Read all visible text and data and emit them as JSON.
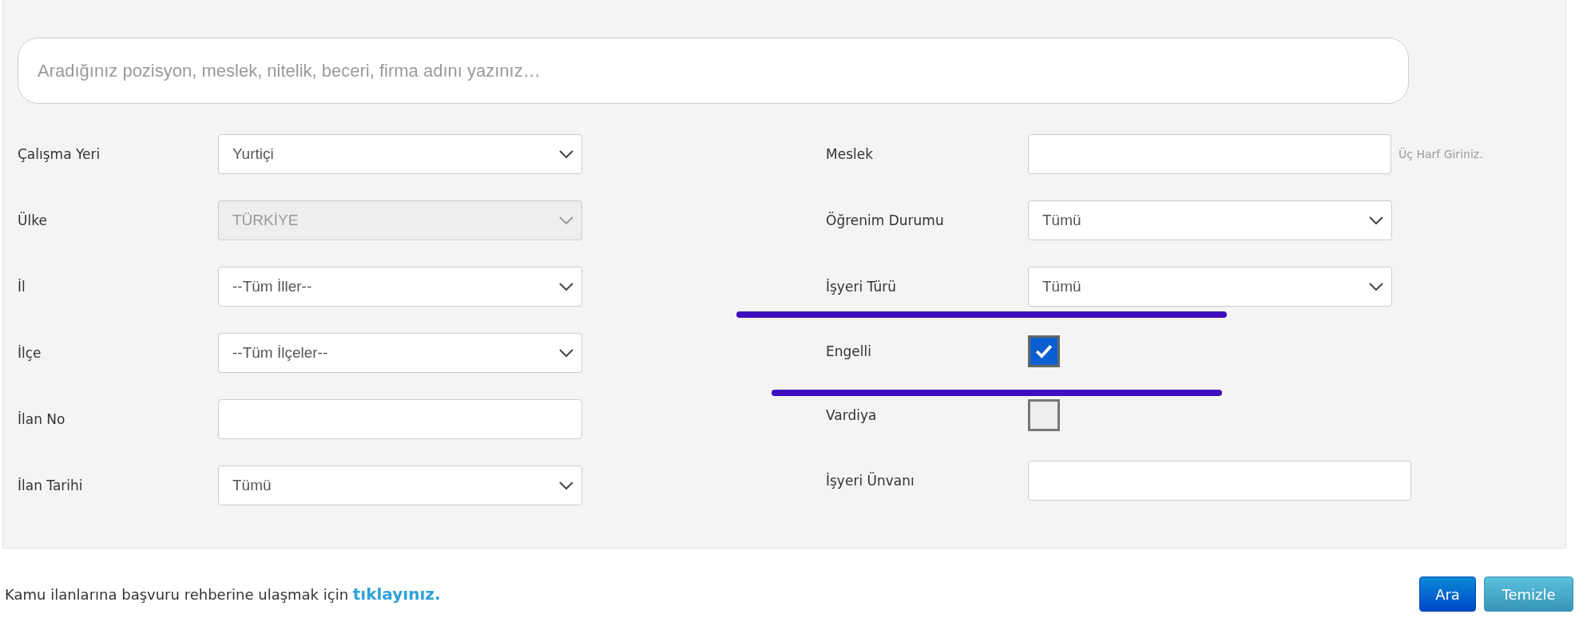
{
  "search": {
    "placeholder": "Aradığınız pozisyon, meslek, nitelik, beceri, firma adını yazınız…"
  },
  "left_fields": [
    {
      "label": "Çalışma Yeri",
      "kind": "select",
      "value": "Yurtiçi",
      "disabled": false
    },
    {
      "label": "Ülke",
      "kind": "select",
      "value": "TÜRKİYE",
      "disabled": true
    },
    {
      "label": "İl",
      "kind": "select",
      "value": "--Tüm İller--",
      "disabled": false
    },
    {
      "label": "İlçe",
      "kind": "select",
      "value": "--Tüm İlçeler--",
      "disabled": false
    },
    {
      "label": "İlan No",
      "kind": "input"
    },
    {
      "label": "İlan Tarihi",
      "kind": "select",
      "value": "Tümü",
      "disabled": false
    }
  ],
  "right_fields": [
    {
      "label": "Meslek",
      "kind": "input",
      "hint": "Üç Harf Giriniz."
    },
    {
      "label": "Öğrenim Durumu",
      "kind": "select",
      "value": "Tümü",
      "disabled": false
    },
    {
      "label": "İşyeri Türü",
      "kind": "select",
      "value": "Tümü",
      "disabled": false
    },
    {
      "label": "Engelli",
      "kind": "checkbox",
      "checked": true
    },
    {
      "label": "Vardiya",
      "kind": "checkbox",
      "checked": false
    },
    {
      "label": "İşyeri Ünvanı",
      "kind": "input"
    }
  ],
  "footer": {
    "text": "Kamu ilanlarına başvuru rehberine ulaşmak için",
    "link": "tıklayınız."
  },
  "buttons": [
    {
      "label": "Ara",
      "kind": "primary"
    },
    {
      "label": "Temizle",
      "kind": "secondary"
    }
  ]
}
